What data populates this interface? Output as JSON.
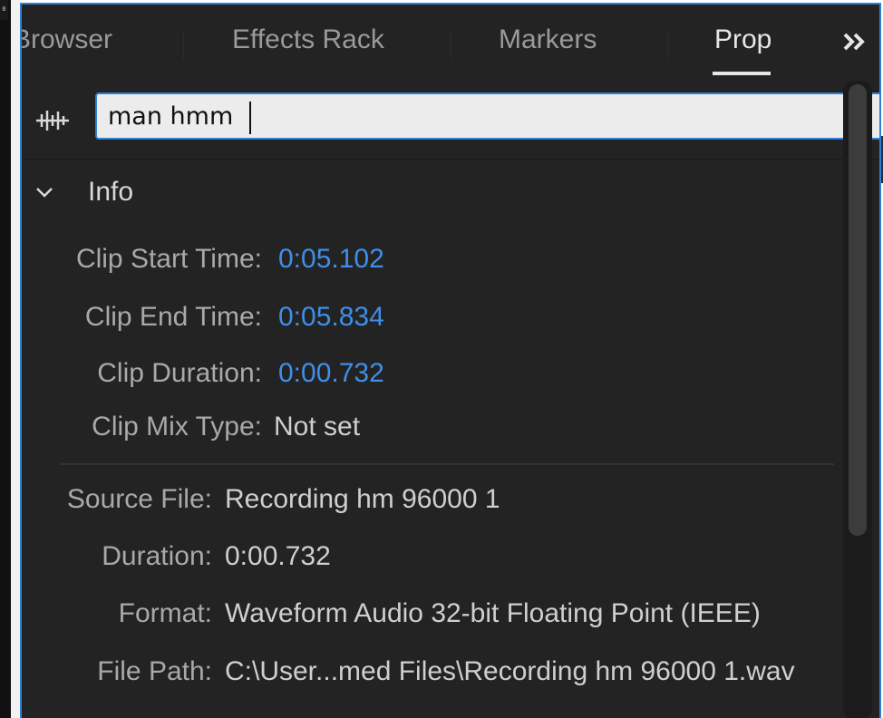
{
  "panel": {
    "tabs": [
      {
        "label": "Browser"
      },
      {
        "label": "Effects Rack"
      },
      {
        "label": "Markers"
      },
      {
        "label": "Properties"
      }
    ],
    "active_tab": "Properties",
    "overflow_label": ">>",
    "accent_color": "#2f7fd4"
  },
  "search": {
    "value": "man hmm",
    "icon": "waveform-icon"
  },
  "info": {
    "title": "Info",
    "collapse_icon": "chevron-down-icon",
    "clip_start_label": "Clip Start Time:",
    "clip_start_value": "0:05.102",
    "clip_end_label": "Clip End Time:",
    "clip_end_value": "0:05.834",
    "clip_duration_label": "Clip Duration:",
    "clip_duration_value": "0:00.732",
    "clip_mix_label": "Clip Mix Type:",
    "clip_mix_value": "Not set",
    "source_file_label": "Source File:",
    "source_file_value": "Recording hm 96000 1",
    "duration_label": "Duration:",
    "duration_value": "0:00.732",
    "format_label": "Format:",
    "format_value": "Waveform Audio 32-bit Floating Point (IEEE)",
    "file_path_label": "File Path:",
    "file_path_value": "C:\\User...med Files\\Recording hm 96000 1.wav"
  }
}
